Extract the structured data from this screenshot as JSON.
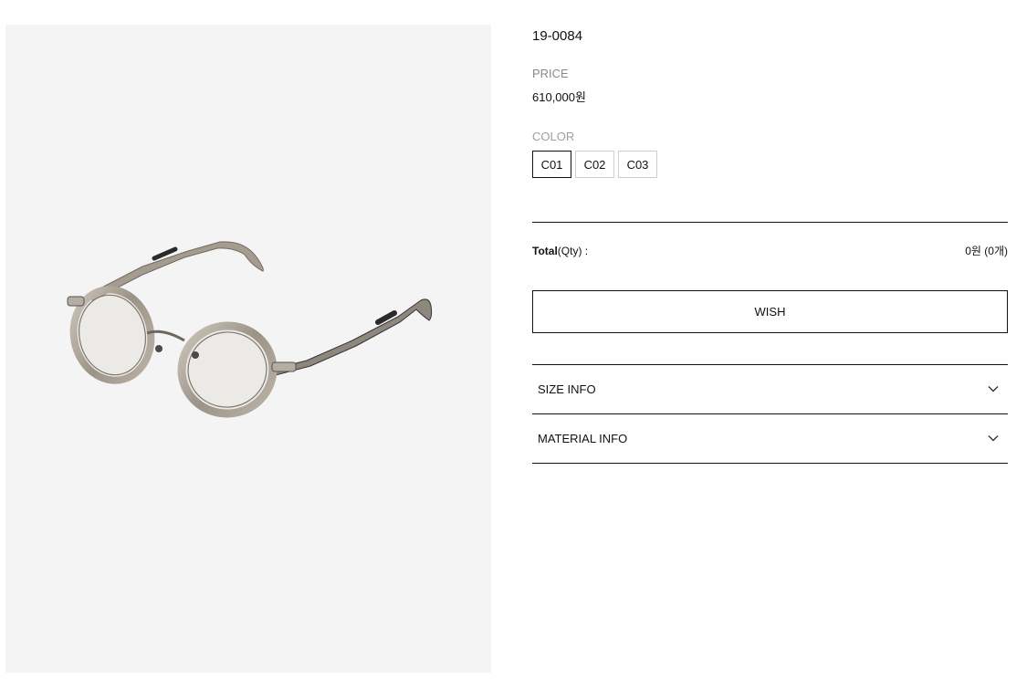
{
  "product": {
    "name": "19-0084",
    "image_alt": "glasses-product-image"
  },
  "price": {
    "label": "PRICE",
    "value": "610,000원"
  },
  "color": {
    "label": "COLOR",
    "options": [
      "C01",
      "C02",
      "C03"
    ],
    "selected": "C01"
  },
  "total": {
    "label_bold": "Total",
    "label_rest": "(Qty) :",
    "value": "0원 (0개)"
  },
  "actions": {
    "wish_label": "WISH"
  },
  "accordion": {
    "size_info": "SIZE INFO",
    "material_info": "MATERIAL INFO"
  },
  "colors": {
    "image_background": "#f4f4f4",
    "text": "#111111",
    "muted": "#8a8a8a"
  }
}
